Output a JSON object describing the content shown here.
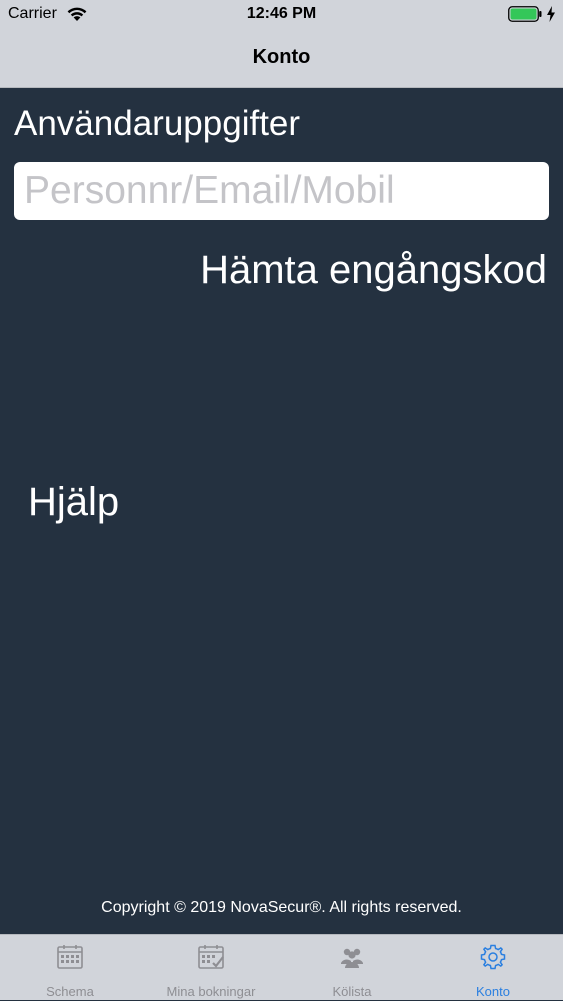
{
  "status_bar": {
    "carrier": "Carrier",
    "time": "12:46 PM",
    "battery_color": "#34c759"
  },
  "nav": {
    "title": "Konto"
  },
  "content": {
    "section_heading": "Användaruppgifter",
    "input_placeholder": "Personnr/Email/Mobil",
    "input_value": "",
    "otp_button_label": "Hämta engångskod",
    "help_label": "Hjälp",
    "copyright": "Copyright © 2019 NovaSecur®. All rights reserved."
  },
  "tab_bar": {
    "active_color": "#2a7fe0",
    "inactive_color": "#8e8e93",
    "items": [
      {
        "label": "Schema",
        "icon": "calendar-icon"
      },
      {
        "label": "Mina bokningar",
        "icon": "calendar-check-icon"
      },
      {
        "label": "Kölista",
        "icon": "people-icon"
      },
      {
        "label": "Konto",
        "icon": "gear-icon",
        "active": true
      }
    ]
  }
}
